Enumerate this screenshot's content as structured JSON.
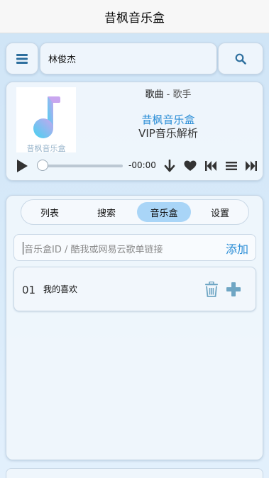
{
  "app": {
    "title": "昔枫音乐盒"
  },
  "search": {
    "value": "林俊杰"
  },
  "player": {
    "song": "歌曲",
    "separator": " - ",
    "artist": "歌手",
    "brand": "昔枫音乐盒",
    "subtitle": "VIP音乐解析",
    "cover_caption": "昔枫音乐盒",
    "time": "-00:00",
    "progress": 0
  },
  "tabs": [
    {
      "label": "列表"
    },
    {
      "label": "搜索"
    },
    {
      "label": "音乐盒"
    },
    {
      "label": "设置"
    }
  ],
  "active_tab": "音乐盒",
  "musicbox": {
    "placeholder": "音乐盒ID / 酷我或网易云歌单链接",
    "add_label": "添加",
    "items": [
      {
        "num": "01",
        "name": "我的喜欢"
      }
    ]
  },
  "colors": {
    "accent": "#2a8dd6",
    "icon": "#2e6f9e",
    "active_tab": "#a9d5f7",
    "item_icon": "#6fa6c4"
  }
}
